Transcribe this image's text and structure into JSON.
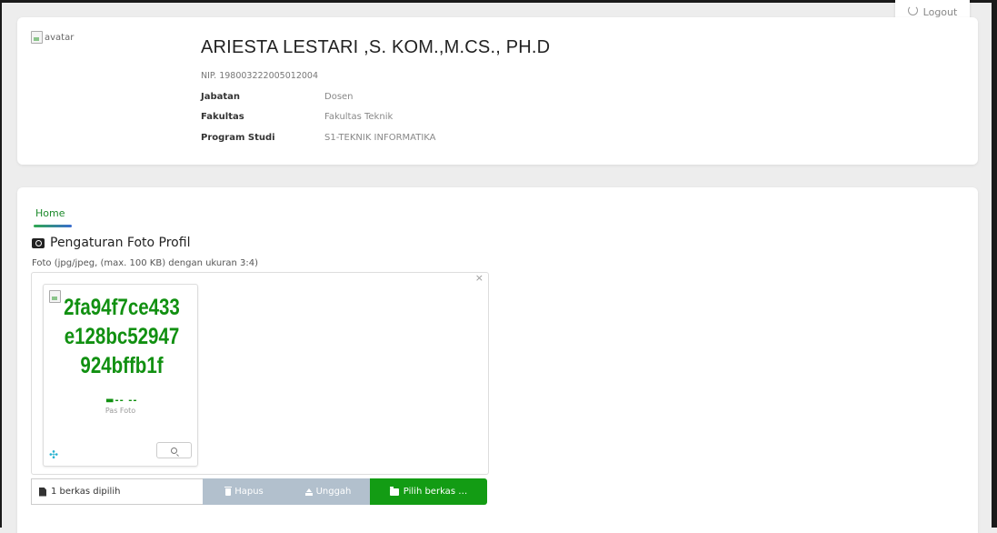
{
  "header": {
    "logout_label": "Logout"
  },
  "profile": {
    "avatar_alt": "avatar",
    "name": "ARIESTA LESTARI ,S. KOM.,M.CS., PH.D",
    "nip": "NIP. 198003222005012004",
    "fields": [
      {
        "label": "Jabatan",
        "value": "Dosen"
      },
      {
        "label": "Fakultas",
        "value": "Fakultas Teknik"
      },
      {
        "label": "Program Studi",
        "value": "S1-TEKNIK INFORMATIKA"
      }
    ]
  },
  "tabs": [
    {
      "label": "Home",
      "active": true
    }
  ],
  "photo_settings": {
    "title": "Pengaturan Foto Profil",
    "hint": "Foto (jpg/jpeg, (max. 100 KB) dengan ukuran 3:4)",
    "close_symbol": "×",
    "preview": {
      "image_alt": "2fa94f7ce433e128bc52947924bffb1f",
      "marker": "▬-- --",
      "caption": "Pas Foto"
    },
    "file_caption": "1 berkas dipilih",
    "remove_label": "Hapus",
    "upload_label": "Unggah",
    "browse_label": "Pilih berkas …"
  },
  "colors": {
    "accent_green": "#139c14",
    "disabled_button": "#b2c0cd",
    "move_handle": "#27b2d0"
  },
  "icons": {
    "logout": "power-icon",
    "camera": "camera-icon",
    "file": "file-icon",
    "remove": "trash-icon",
    "upload": "upload-icon",
    "browse": "folder-open-icon",
    "move": "move-icon",
    "zoom": "zoom-icon"
  }
}
